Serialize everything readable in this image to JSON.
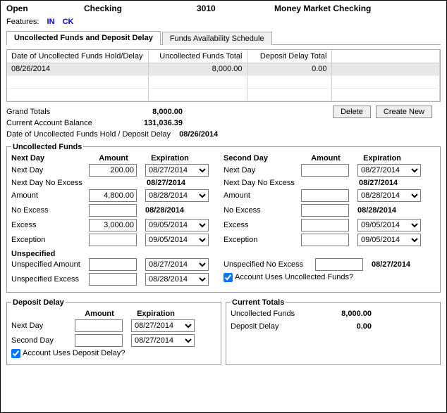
{
  "header": {
    "status": "Open",
    "product": "Checking",
    "code": "3010",
    "name": "Money Market Checking"
  },
  "features": {
    "label": "Features:",
    "items": [
      "IN",
      "CK"
    ]
  },
  "tabs": {
    "active": "Uncollected Funds and Deposit Delay",
    "other": "Funds Availability Schedule"
  },
  "grid": {
    "headers": {
      "c1": "Date of Uncollected Funds Hold/Delay",
      "c2": "Uncollected Funds Total",
      "c3": "Deposit Delay Total"
    },
    "rows": [
      {
        "date": "08/26/2014",
        "ucf": "8,000.00",
        "dd": "0.00"
      }
    ]
  },
  "totals": {
    "grand_label": "Grand Totals",
    "grand_value": "8,000.00",
    "balance_label": "Current Account Balance",
    "balance_value": "131,036.39"
  },
  "buttons": {
    "delete": "Delete",
    "create_new": "Create New"
  },
  "date_hold": {
    "label": "Date of Uncollected Funds Hold / Deposit Delay",
    "value": "08/26/2014"
  },
  "ucf": {
    "legend": "Uncollected Funds",
    "head": {
      "nextday": "Next Day",
      "amount": "Amount",
      "expiration": "Expiration",
      "secondday": "Second Day"
    },
    "left": {
      "next_day_l": "Next Day",
      "next_day_amt": "200.00",
      "next_day_exp": "08/27/2014",
      "next_day_ne_l": "Next Day No Excess",
      "next_day_ne_exp": "08/27/2014",
      "amount_l": "Amount",
      "amount_amt": "4,800.00",
      "amount_exp": "08/28/2014",
      "no_excess_l": "No Excess",
      "no_excess_exp": "08/28/2014",
      "excess_l": "Excess",
      "excess_amt": "3,000.00",
      "excess_exp": "09/05/2014",
      "exception_l": "Exception",
      "exception_exp": "09/05/2014"
    },
    "right": {
      "next_day_l": "Next Day",
      "next_day_exp": "08/27/2014",
      "next_day_ne_l": "Next Day No Excess",
      "next_day_ne_exp": "08/27/2014",
      "amount_l": "Amount",
      "amount_exp": "08/28/2014",
      "no_excess_l": "No Excess",
      "no_excess_exp": "08/28/2014",
      "excess_l": "Excess",
      "excess_exp": "09/05/2014",
      "exception_l": "Exception",
      "exception_exp": "09/05/2014"
    },
    "unspec": {
      "legend": "Unspecified",
      "ua_l": "Unspecified Amount",
      "ua_exp": "08/27/2014",
      "ue_l": "Unspecified Excess",
      "ue_exp": "08/28/2014",
      "une_l": "Unspecified No Excess",
      "une_exp": "08/27/2014",
      "chk_label": "Account Uses Uncollected Funds?"
    }
  },
  "dd": {
    "legend": "Deposit Delay",
    "head": {
      "amount": "Amount",
      "expiration": "Expiration"
    },
    "next_day_l": "Next Day",
    "next_day_exp": "08/27/2014",
    "second_day_l": "Second Day",
    "second_day_exp": "08/27/2014",
    "chk_label": "Account Uses Deposit Delay?"
  },
  "ct": {
    "legend": "Current Totals",
    "ucf_l": "Uncollected Funds",
    "ucf_v": "8,000.00",
    "dd_l": "Deposit Delay",
    "dd_v": "0.00"
  }
}
